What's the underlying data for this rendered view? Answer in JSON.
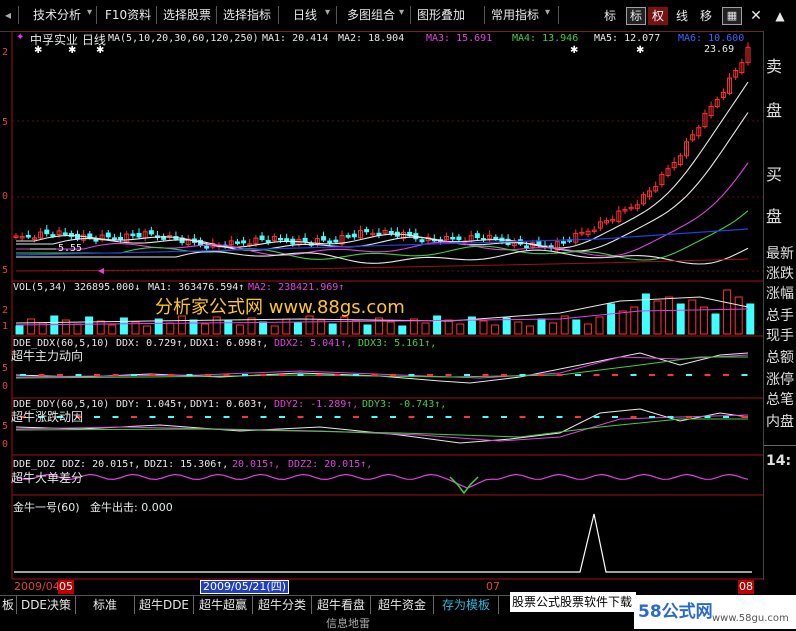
{
  "menubar": {
    "items": [
      "技术分析",
      "F10资料",
      "选择股票",
      "选择指标",
      "日线",
      "多图组合",
      "图形叠加",
      "常用指标"
    ],
    "tool_buttons": [
      "标",
      "标",
      "权",
      "线",
      "移"
    ]
  },
  "main_panel": {
    "title": "中孚实业 日线",
    "ma_params": "MA(5,10,20,30,60,120,250)",
    "ma_values": [
      {
        "label": "MA1: 20.414",
        "color": "#e8e8e8"
      },
      {
        "label": "MA2: 18.904",
        "color": "#e8e8e8"
      },
      {
        "label": "MA3: 15.691",
        "color": "#e040e0"
      },
      {
        "label": "MA4: 13.946",
        "color": "#40d040"
      },
      {
        "label": "MA5: 12.077",
        "color": "#e8e8e8"
      },
      {
        "label": "MA6: 10.600",
        "color": "#4060ff"
      }
    ],
    "price_high": "23.69",
    "price_low": "5.55",
    "y_ticks": [
      "2",
      "5",
      "0",
      "5"
    ]
  },
  "vol_panel": {
    "label": "VOL(5,34)",
    "value": "326895.000↓",
    "ma1": "MA1: 363476.594↑",
    "ma2": "MA2: 238421.969↑",
    "y_ticks": [
      "2",
      "1"
    ]
  },
  "watermark": "分析家公式网 www.88gs.com",
  "ddx_panel": {
    "header": "DDE_DDX(60,5,10)",
    "values": [
      {
        "label": "DDX: 0.729↑,",
        "color": "#e8e8e8"
      },
      {
        "label": "DDX1: 6.098↑,",
        "color": "#e8e8e8"
      },
      {
        "label": "DDX2: 5.041↑,",
        "color": "#e040e0"
      },
      {
        "label": "DDX3: 5.161↑,",
        "color": "#40d040"
      }
    ],
    "name": "超牛主力动向",
    "y_ticks": [
      "5",
      "0"
    ]
  },
  "ddy_panel": {
    "header": "DDE_DDY(60,5,10)",
    "values": [
      {
        "label": "DDY: 1.045↑,",
        "color": "#e8e8e8"
      },
      {
        "label": "DDY1: 0.603↑,",
        "color": "#e8e8e8"
      },
      {
        "label": "DDY2: -1.289↑,",
        "color": "#e040e0"
      },
      {
        "label": "DDY3: -0.743↑,",
        "color": "#40d040"
      }
    ],
    "name": "超牛涨跌动因",
    "y_ticks": [
      "5",
      "0"
    ]
  },
  "ddz_panel": {
    "header": "DDE_DDZ",
    "values": [
      {
        "label": "DDZ: 20.015↑,",
        "color": "#e8e8e8"
      },
      {
        "label": "DDZ1: 15.306↑,",
        "color": "#e8e8e8"
      },
      {
        "label": "20.015↑,",
        "color": "#e040e0"
      },
      {
        "label": "DDZ2: 20.015↑,",
        "color": "#e040e0"
      }
    ],
    "name": "超牛大单差分"
  },
  "jinniu_panel": {
    "header": "金牛一号(60)",
    "signal": "金牛出击: 0.000"
  },
  "right_panel": {
    "items": [
      "卖",
      "盘",
      "买",
      "盘"
    ],
    "stats": [
      "最新",
      "涨跌",
      "涨幅",
      "总手",
      "现手",
      "总额",
      "涨停",
      "总笔",
      "内盘"
    ],
    "time": "14:"
  },
  "date_strip": {
    "start": "2009/04",
    "start_mark": "05",
    "cursor": "2009/05/21(四)",
    "mid": "07",
    "end": "08"
  },
  "bottom_tabs": [
    "板",
    "DDE决策",
    "标准",
    "超牛DDE",
    "超牛超赢",
    "超牛分类",
    "超牛看盘",
    "超牛资金",
    "存为模板"
  ],
  "selected_tab": "存为模板",
  "ad_text": "股票公式股票软件下载",
  "status_text": "信息地雷",
  "logo": {
    "text": "58公式网",
    "url_text": "www.58gu.com"
  },
  "colors": {
    "up": "#ff3030",
    "down": "#40ffff",
    "ma_white": "#e8e8e8",
    "ma_magenta": "#e040e0",
    "ma_green": "#40d040",
    "ma_blue": "#2040e0",
    "accent_red": "#c00000",
    "watermark": "#ffc820"
  }
}
